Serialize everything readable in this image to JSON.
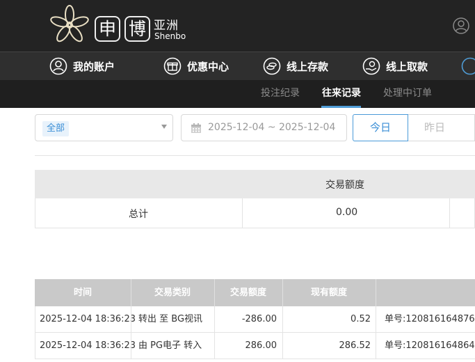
{
  "brand": {
    "name_cn_1": "申",
    "name_cn_2": "博",
    "region": "亚洲",
    "name_en": "Shenbo"
  },
  "nav": {
    "items": [
      {
        "label": "我的账户",
        "icon": "user-circle-icon"
      },
      {
        "label": "优惠中心",
        "icon": "gift-icon"
      },
      {
        "label": "线上存款",
        "icon": "deposit-coin-icon"
      },
      {
        "label": "线上取款",
        "icon": "withdraw-hand-icon"
      }
    ]
  },
  "subnav": {
    "tabs": [
      {
        "label": "投注纪录",
        "active": false
      },
      {
        "label": "往来记录",
        "active": true
      },
      {
        "label": "处理中订单",
        "active": false
      }
    ]
  },
  "filters": {
    "type_selected": "全部",
    "date_range": "2025-12-04 ~ 2025-12-04",
    "today_label": "今日",
    "yesterday_label": "昨日"
  },
  "summary": {
    "header": "交易额度",
    "row_label": "总计",
    "total": "0.00"
  },
  "table": {
    "columns": [
      "时间",
      "交易类别",
      "交易额度",
      "现有额度"
    ],
    "rows": [
      {
        "time": "2025-12-04 18:36:23",
        "type": "转出 至 BG视讯",
        "amount": "-286.00",
        "balance": "0.52",
        "ref": "单号:120816164876"
      },
      {
        "time": "2025-12-04 18:36:23",
        "type": "由 PG电子 转入",
        "amount": "286.00",
        "balance": "286.52",
        "ref": "单号:120816164864"
      }
    ]
  },
  "colors": {
    "accent": "#3a8ed6",
    "header_bg": "#232323",
    "nav_bg": "#2f2f2f"
  }
}
